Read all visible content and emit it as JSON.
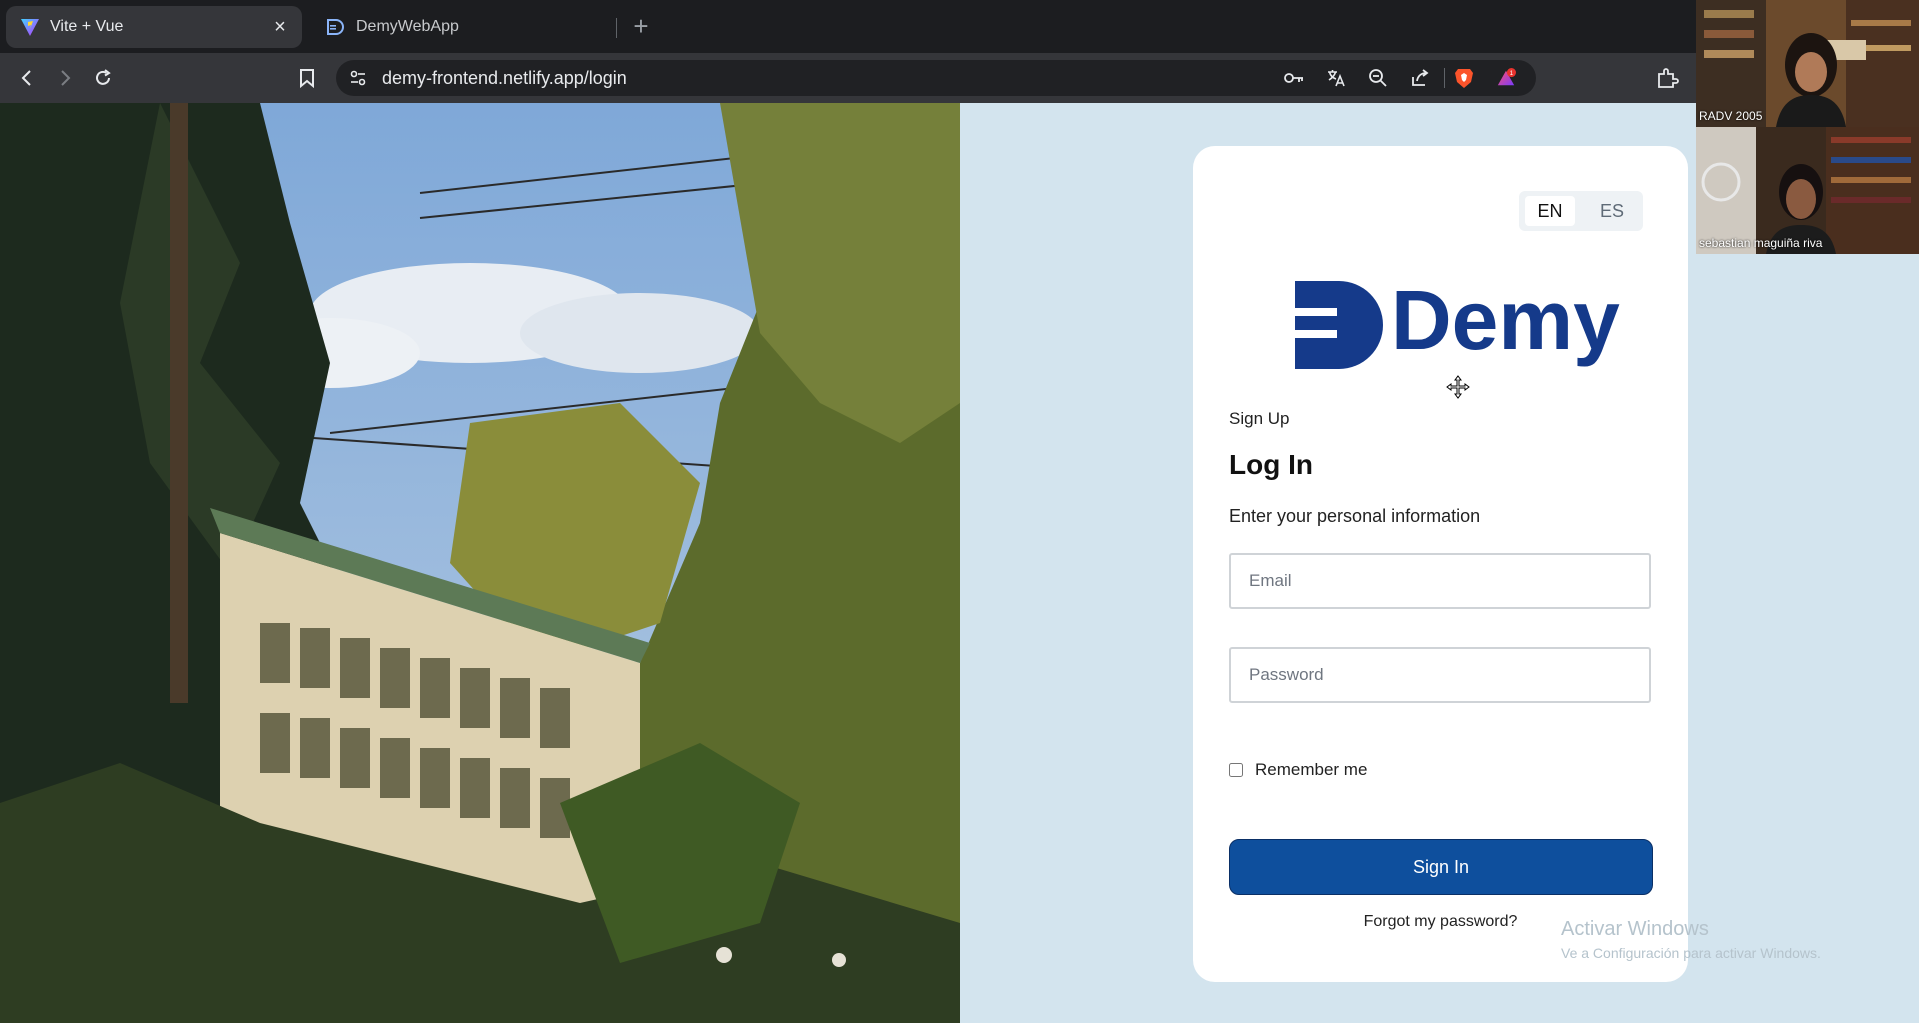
{
  "browser": {
    "tabs": [
      {
        "title": "Vite + Vue",
        "active": true,
        "favicon": "vite-icon"
      },
      {
        "title": "DemyWebApp",
        "active": false,
        "favicon": "demy-icon"
      }
    ],
    "close_glyph": "×",
    "new_tab_glyph": "+",
    "url": "demy-frontend.netlify.app/login",
    "shield_badge": "1"
  },
  "login": {
    "languages": [
      "EN",
      "ES"
    ],
    "selected_language": "EN",
    "logo_text": "Demy",
    "signup_link": "Sign Up",
    "title": "Log In",
    "subtitle": "Enter your personal information",
    "email_placeholder": "Email",
    "password_placeholder": "Password",
    "remember_label": "Remember me",
    "signin_label": "Sign In",
    "forgot_link": "Forgot my password?"
  },
  "watermark": {
    "line1": "Activar Windows",
    "line2": "Ve a Configuración para activar Windows."
  },
  "video_tiles": [
    {
      "name": "RADV 2005"
    },
    {
      "name": "sebastian maguiña riva"
    }
  ],
  "colors": {
    "brand": "#0e4f9d",
    "page_bg": "#d3e4ee",
    "logo": "#153a8a"
  }
}
